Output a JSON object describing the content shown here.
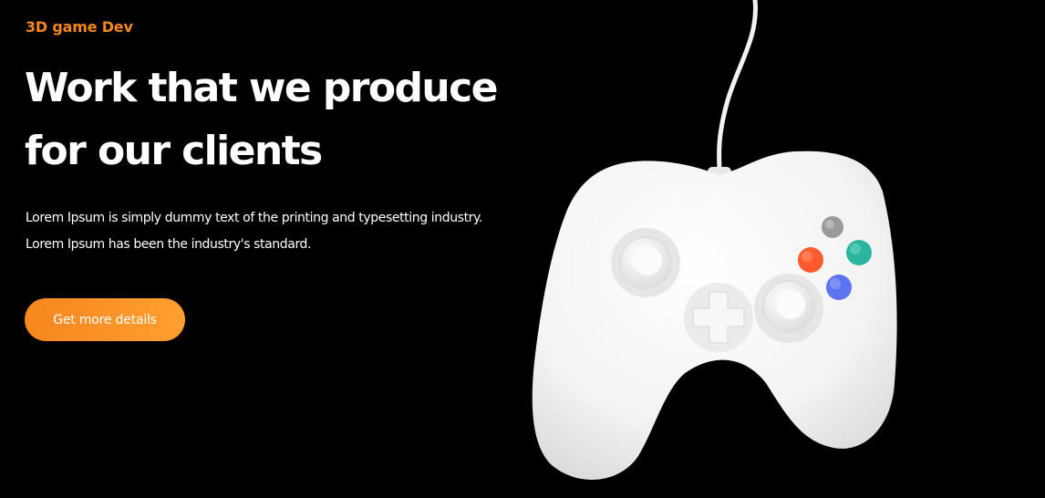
{
  "hero": {
    "eyebrow": "3D game Dev",
    "headline_line1": "Work that we produce",
    "headline_line2": "for our clients",
    "body_line1": "Lorem Ipsum is simply dummy text of the printing and typesetting industry.",
    "body_line2": "Lorem Ipsum has been the industry's standard.",
    "cta_label": "Get more details"
  },
  "colors": {
    "background": "#000000",
    "accent": "#F7861F",
    "button_gradient_start": "#F7861F",
    "button_gradient_end": "#FF9F30",
    "heading": "#FFFFFF",
    "controller_body": "#F4F4F4",
    "button_gray": "#9A9A9A",
    "button_red": "#FF5A2E",
    "button_teal": "#2BB59E",
    "button_blue": "#5C73F2"
  },
  "image": {
    "icon": "gamepad-controller-icon"
  }
}
